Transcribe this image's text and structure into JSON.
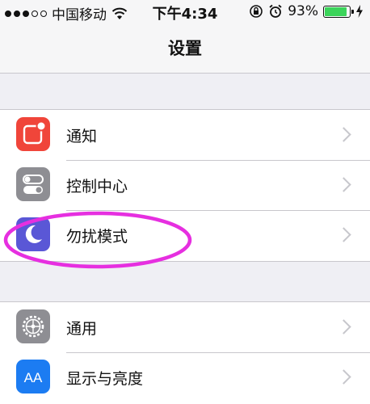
{
  "status_bar": {
    "carrier": "中国移动",
    "time": "下午4:34",
    "battery_percent_text": "93%",
    "battery_level": 0.93,
    "signal_dots_filled": 3,
    "signal_dots_total": 5
  },
  "nav": {
    "title": "设置"
  },
  "settings": {
    "group1": [
      {
        "label": "通知",
        "icon": "notifications-icon",
        "color": "#f0453a"
      },
      {
        "label": "控制中心",
        "icon": "control-center-icon",
        "color": "#8e8e93"
      },
      {
        "label": "勿扰模式",
        "icon": "moon-icon",
        "color": "#5a57d6"
      }
    ],
    "group2": [
      {
        "label": "通用",
        "icon": "gear-icon",
        "color": "#8e8e93"
      },
      {
        "label": "显示与亮度",
        "icon": "display-brightness-icon",
        "color": "#1c7cf2"
      }
    ]
  },
  "display_icon_text": "AA",
  "annotation": {
    "color": "#e62fe0"
  }
}
